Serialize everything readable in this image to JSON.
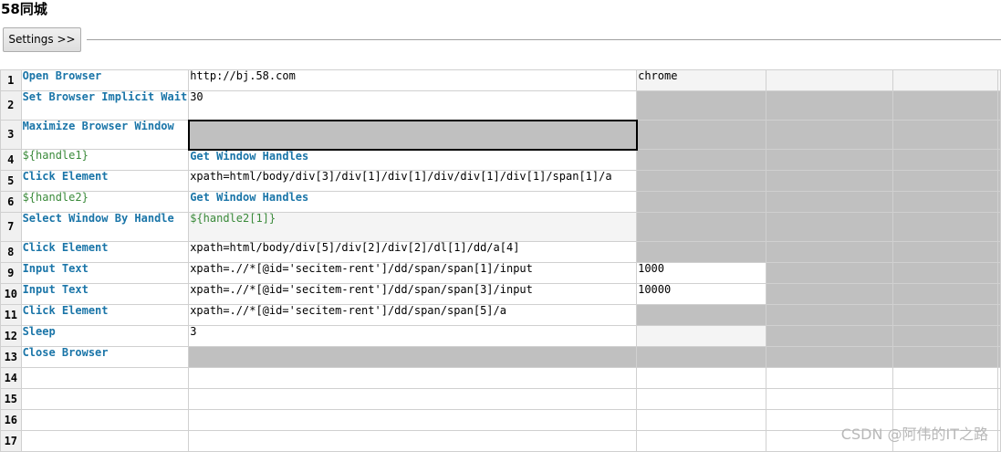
{
  "title": "58同城",
  "settings_button": "Settings >>",
  "rows": [
    {
      "num": "1",
      "cells": [
        "Open Browser",
        "http://bj.58.com",
        "chrome",
        "",
        ""
      ]
    },
    {
      "num": "2",
      "cells": [
        "Set Browser Implicit Wait",
        "30",
        "",
        "",
        ""
      ]
    },
    {
      "num": "3",
      "cells": [
        "Maximize Browser Window",
        "",
        "",
        "",
        ""
      ]
    },
    {
      "num": "4",
      "cells": [
        "${handle1}",
        "Get Window Handles",
        "",
        "",
        ""
      ]
    },
    {
      "num": "5",
      "cells": [
        "Click Element",
        "xpath=html/body/div[3]/div[1]/div[1]/div/div[1]/div[1]/span[1]/a",
        "",
        "",
        ""
      ]
    },
    {
      "num": "6",
      "cells": [
        "${handle2}",
        "Get Window Handles",
        "",
        "",
        ""
      ]
    },
    {
      "num": "7",
      "cells": [
        "Select Window By Handle",
        "${handle2[1]}",
        "",
        "",
        ""
      ]
    },
    {
      "num": "8",
      "cells": [
        "Click Element",
        "xpath=html/body/div[5]/div[2]/div[2]/dl[1]/dd/a[4]",
        "",
        "",
        ""
      ]
    },
    {
      "num": "9",
      "cells": [
        "Input Text",
        "xpath=.//*[@id='secitem-rent']/dd/span/span[1]/input",
        "1000",
        "",
        ""
      ]
    },
    {
      "num": "10",
      "cells": [
        "Input Text",
        "xpath=.//*[@id='secitem-rent']/dd/span/span[3]/input",
        "10000",
        "",
        ""
      ]
    },
    {
      "num": "11",
      "cells": [
        "Click Element",
        "xpath=.//*[@id='secitem-rent']/dd/span/span[5]/a",
        "",
        "",
        ""
      ]
    },
    {
      "num": "12",
      "cells": [
        "Sleep",
        "3",
        "",
        "",
        ""
      ]
    },
    {
      "num": "13",
      "cells": [
        "Close Browser",
        "",
        "",
        "",
        ""
      ]
    },
    {
      "num": "14",
      "cells": [
        "",
        "",
        "",
        "",
        ""
      ]
    },
    {
      "num": "15",
      "cells": [
        "",
        "",
        "",
        "",
        ""
      ]
    },
    {
      "num": "16",
      "cells": [
        "",
        "",
        "",
        "",
        ""
      ]
    },
    {
      "num": "17",
      "cells": [
        "",
        "",
        "",
        "",
        ""
      ]
    }
  ],
  "watermark": "CSDN @阿伟的IT之路"
}
